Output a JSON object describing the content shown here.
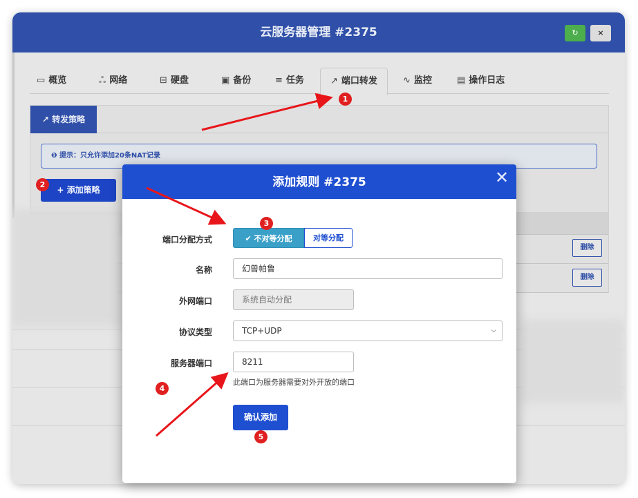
{
  "window": {
    "title": "云服务器管理 #2375",
    "refresh_icon": "↻",
    "close_icon": "×"
  },
  "tabs": [
    {
      "icon": "▭",
      "label": "概览"
    },
    {
      "icon": "ஃ",
      "label": "网络"
    },
    {
      "icon": "⊟",
      "label": "硬盘"
    },
    {
      "icon": "▣",
      "label": "备份"
    },
    {
      "icon": "≡",
      "label": "任务"
    },
    {
      "icon": "↗",
      "label": "端口转发"
    },
    {
      "icon": "∿",
      "label": "监控"
    },
    {
      "icon": "▤",
      "label": "操作日志"
    }
  ],
  "active_tab": "端口转发",
  "panel": {
    "tab_label": "转发策略",
    "tab_icon": "↗",
    "notice_icon": "❶",
    "notice": "提示：只允许添加20条NAT记录",
    "add_button": "+ 添加策略",
    "delete_label": "删除"
  },
  "modal": {
    "title": "添加规则 #2375",
    "close_icon": "✕",
    "fields": {
      "alloc_label": "端口分配方式",
      "alloc_options": [
        "✔ 不对等分配",
        "对等分配"
      ],
      "alloc_selected": "不对等分配",
      "name_label": "名称",
      "name_value": "幻兽帕鲁",
      "ext_port_label": "外网端口",
      "ext_port_placeholder": "系统自动分配",
      "protocol_label": "协议类型",
      "protocol_value": "TCP+UDP",
      "server_port_label": "服务器端口",
      "server_port_value": "8211",
      "help_text": "此端口为服务器需要对外开放的端口"
    },
    "confirm_button": "确认添加"
  },
  "badges": [
    "1",
    "2",
    "3",
    "4",
    "5"
  ],
  "colors": {
    "header": "#2f4fa8",
    "modal_header": "#1f4fd1",
    "badge": "#e02020",
    "selected_segment": "#3aa0c8"
  }
}
